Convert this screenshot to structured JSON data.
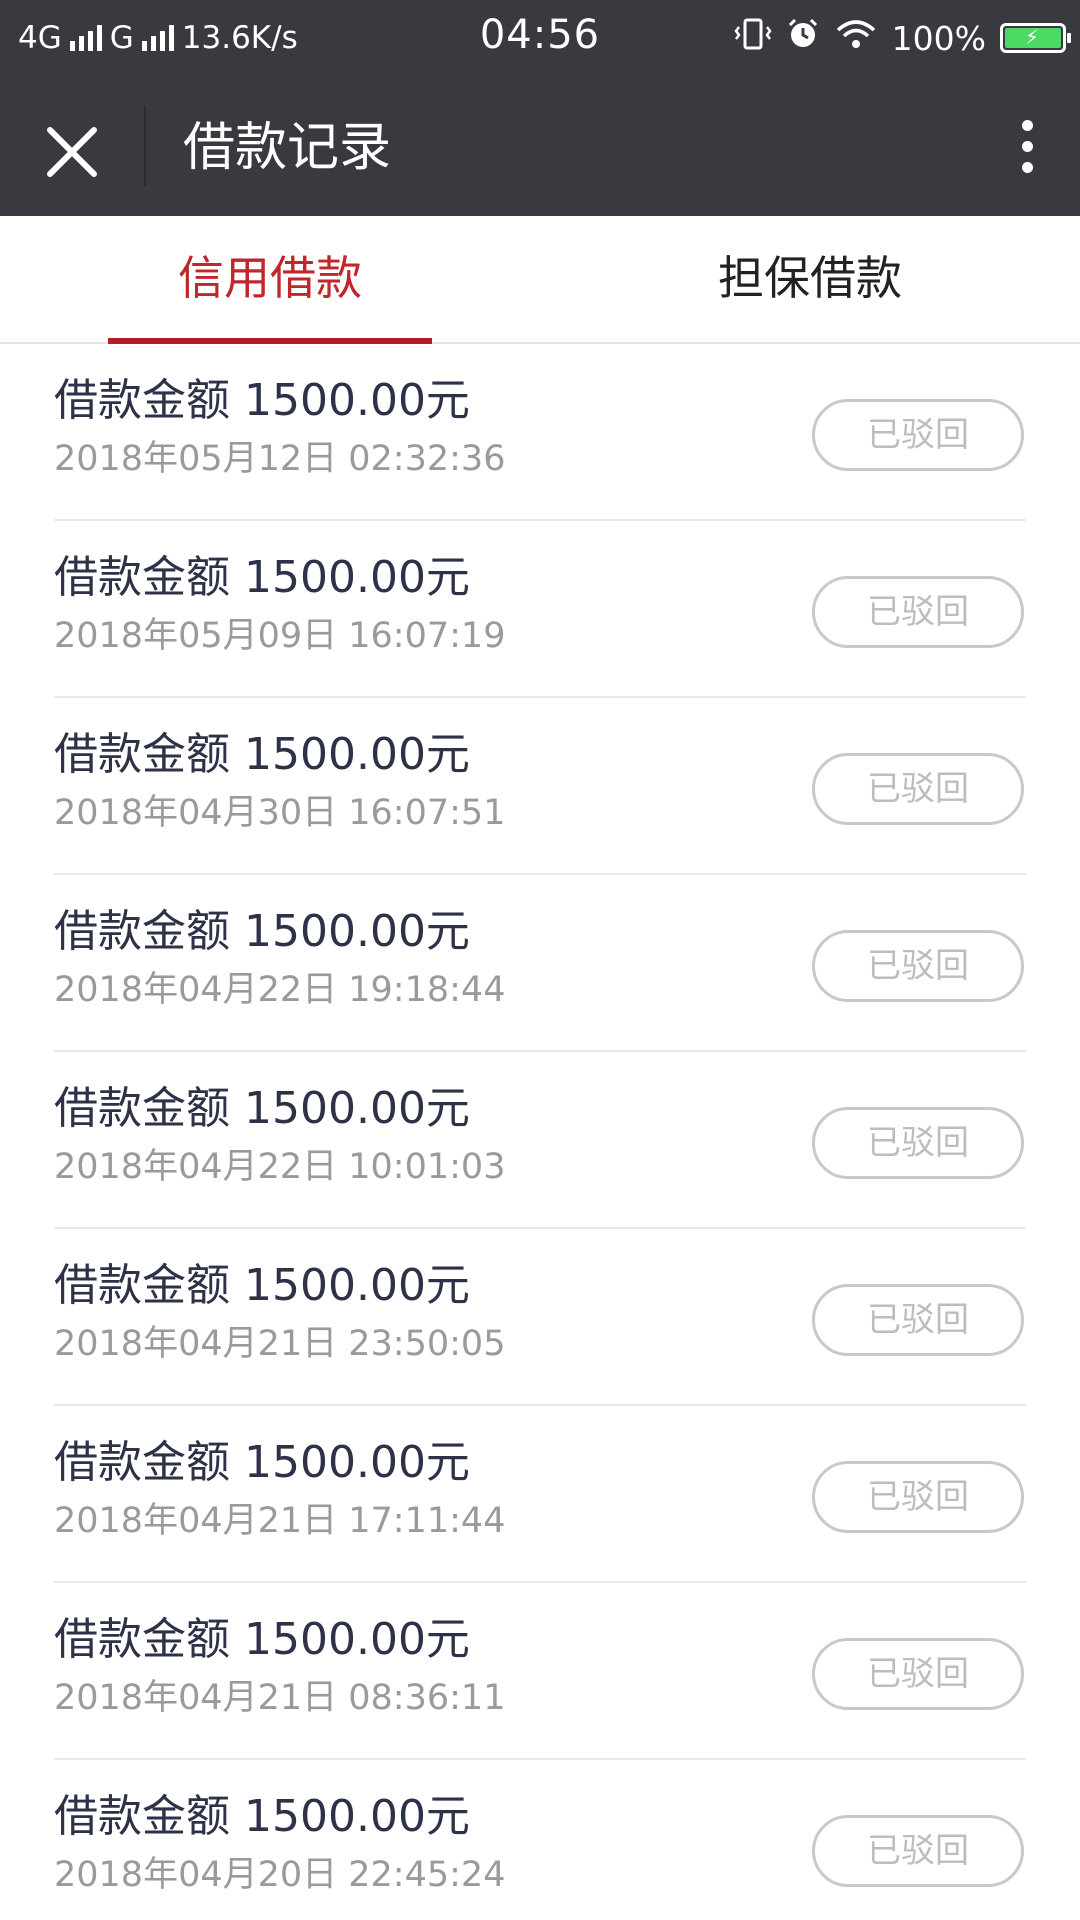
{
  "status_bar": {
    "network_1": "4G",
    "network_2": "G",
    "speed": "13.6K/s",
    "time": "04:56",
    "battery": "100%"
  },
  "nav": {
    "title": "借款记录"
  },
  "tabs": [
    {
      "label": "信用借款",
      "active": true
    },
    {
      "label": "担保借款",
      "active": false
    }
  ],
  "records": [
    {
      "amount": "借款金额 1500.00元",
      "date": "2018年05月12日 02:32:36",
      "status": "已驳回"
    },
    {
      "amount": "借款金额 1500.00元",
      "date": "2018年05月09日 16:07:19",
      "status": "已驳回"
    },
    {
      "amount": "借款金额 1500.00元",
      "date": "2018年04月30日 16:07:51",
      "status": "已驳回"
    },
    {
      "amount": "借款金额 1500.00元",
      "date": "2018年04月22日 19:18:44",
      "status": "已驳回"
    },
    {
      "amount": "借款金额 1500.00元",
      "date": "2018年04月22日 10:01:03",
      "status": "已驳回"
    },
    {
      "amount": "借款金额 1500.00元",
      "date": "2018年04月21日 23:50:05",
      "status": "已驳回"
    },
    {
      "amount": "借款金额 1500.00元",
      "date": "2018年04月21日 17:11:44",
      "status": "已驳回"
    },
    {
      "amount": "借款金额 1500.00元",
      "date": "2018年04月21日 08:36:11",
      "status": "已驳回"
    },
    {
      "amount": "借款金额 1500.00元",
      "date": "2018年04月20日 22:45:24",
      "status": "已驳回"
    }
  ]
}
